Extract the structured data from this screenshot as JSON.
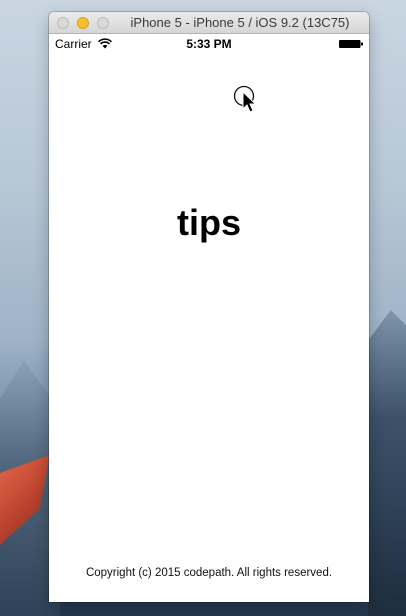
{
  "window": {
    "title": "iPhone 5 - iPhone 5 / iOS 9.2 (13C75)"
  },
  "status_bar": {
    "carrier": "Carrier",
    "time": "5:33 PM"
  },
  "app": {
    "title": "tips",
    "copyright": "Copyright (c) 2015 codepath. All rights reserved."
  },
  "colors": {
    "traffic_minimize": "#f5bf2e",
    "background_text": "#000000"
  },
  "icons": {
    "wifi": "wifi-icon",
    "battery": "battery-icon",
    "cursor": "touch-cursor-icon"
  }
}
